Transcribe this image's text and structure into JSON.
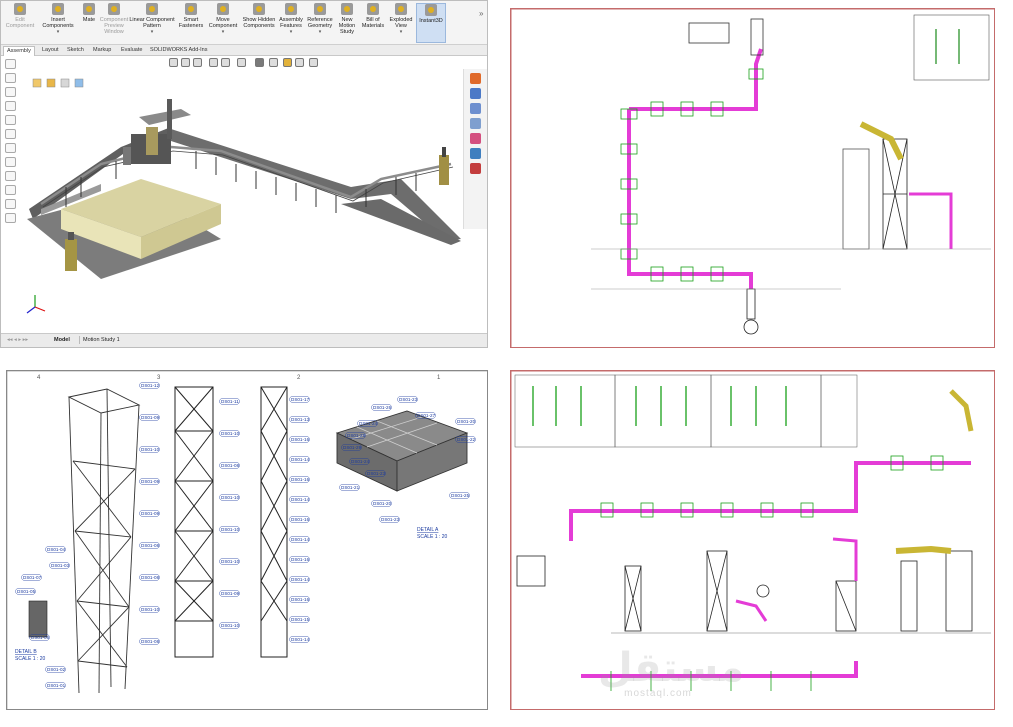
{
  "solidworks": {
    "toolbar": [
      {
        "label": "Edit Component",
        "state": "disabled"
      },
      {
        "label": "Insert Components",
        "state": "normal"
      },
      {
        "label": "Mate",
        "state": "normal"
      },
      {
        "label": "Component Preview Window",
        "state": "disabled"
      },
      {
        "label": "Linear Component Pattern",
        "state": "normal"
      },
      {
        "label": "Smart Fasteners",
        "state": "normal"
      },
      {
        "label": "Move Component",
        "state": "normal"
      },
      {
        "label": "Show Hidden Components",
        "state": "normal"
      },
      {
        "label": "Assembly Features",
        "state": "normal"
      },
      {
        "label": "Reference Geometry",
        "state": "normal"
      },
      {
        "label": "New Motion Study",
        "state": "normal"
      },
      {
        "label": "Bill of Materials",
        "state": "normal"
      },
      {
        "label": "Exploded View",
        "state": "normal"
      },
      {
        "label": "Instant3D",
        "state": "active"
      }
    ],
    "tabs": [
      "Assembly",
      "Layout",
      "Sketch",
      "Markup",
      "Evaluate",
      "SOLIDWORKS Add-Ins"
    ],
    "active_tab": "Assembly",
    "bottom_tabs": [
      "Model",
      "Motion Study 1"
    ],
    "active_bottom_tab": "Model",
    "colors": {
      "accent": "#cfdff3",
      "pipe": "#8c8c8c",
      "tank": "#e9e4b8"
    }
  },
  "drawing_mid": {
    "callouts_left": [
      "DS01-04",
      "DS01-03",
      "DS01-07",
      "DS01-05",
      "DS01-06",
      "DS01-02",
      "DS01-01"
    ],
    "callouts_frame2": [
      "DS01-12",
      "DS01-11",
      "DS01-09",
      "DS01-10",
      "DS01-10",
      "DS01-08",
      "DS01-09",
      "DS01-10",
      "DS01-09",
      "DS01-10",
      "DS01-08",
      "DS01-10",
      "DS01-08",
      "DS01-09",
      "DS01-10",
      "DS01-10",
      "DS01-08"
    ],
    "callouts_frame3": [
      "DS01-17",
      "DS01-13",
      "DS01-16",
      "DS01-14",
      "DS01-16",
      "DS01-14",
      "DS01-16",
      "DS01-14",
      "DS01-16",
      "DS01-14",
      "DS01-16",
      "DS01-15",
      "DS01-14"
    ],
    "callouts_grid": [
      "DS01-26",
      "DS01-23",
      "DS01-24",
      "DS01-27",
      "DS01-28",
      "DS01-20",
      "DS01-29",
      "DS01-22",
      "DS01-24",
      "DS01-23",
      "DS01-21",
      "DS01-25",
      "DS01-20",
      "DS01-23"
    ],
    "detail_a": [
      "DETAIL A",
      "SCALE 1 : 20"
    ],
    "detail_b": [
      "DETAIL B",
      "SCALE 1 : 20"
    ],
    "frame_numbers": [
      "1",
      "2",
      "3",
      "4"
    ]
  },
  "watermark": {
    "arabic": "مستقل",
    "latin": "mostaql.com"
  }
}
